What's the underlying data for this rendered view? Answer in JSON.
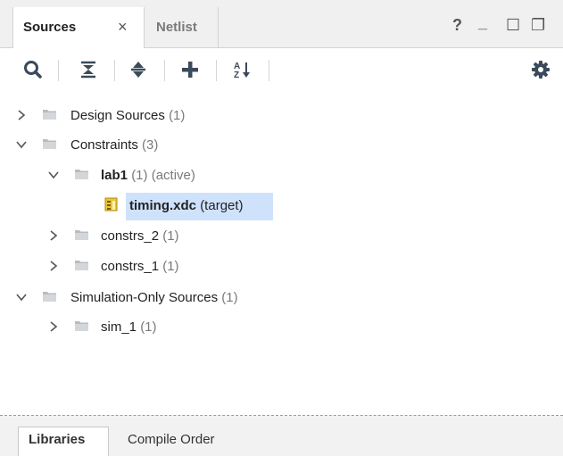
{
  "tabs": {
    "sources": "Sources",
    "close": "×",
    "netlist": "Netlist"
  },
  "window_controls": {
    "help": "?",
    "minimize": "_",
    "maximize": "☐",
    "restore": "❐"
  },
  "toolbar": {
    "icons": [
      "search-icon",
      "collapse-all-icon",
      "expand-all-icon",
      "add-icon",
      "sort-icon",
      "gear-icon"
    ]
  },
  "tree": {
    "design_sources": {
      "name": "Design Sources",
      "count": "(1)"
    },
    "constraints": {
      "name": "Constraints",
      "count": "(3)"
    },
    "lab1": {
      "name": "lab1",
      "count": "(1)",
      "status": "(active)"
    },
    "timing_xdc": {
      "name": "timing.xdc",
      "status": "(target)"
    },
    "constrs_2": {
      "name": "constrs_2",
      "count": "(1)"
    },
    "constrs_1": {
      "name": "constrs_1",
      "count": "(1)"
    },
    "simulation_sources": {
      "name": "Simulation-Only Sources",
      "count": "(1)"
    },
    "sim_1": {
      "name": "sim_1",
      "count": "(1)"
    }
  },
  "bottom_tabs": {
    "libraries": "Libraries",
    "compile_order": "Compile Order"
  },
  "colors": {
    "selection": "#cfe2fb",
    "tabbar": "#f0f0f0",
    "accent_icon": "#3a4a5a"
  }
}
